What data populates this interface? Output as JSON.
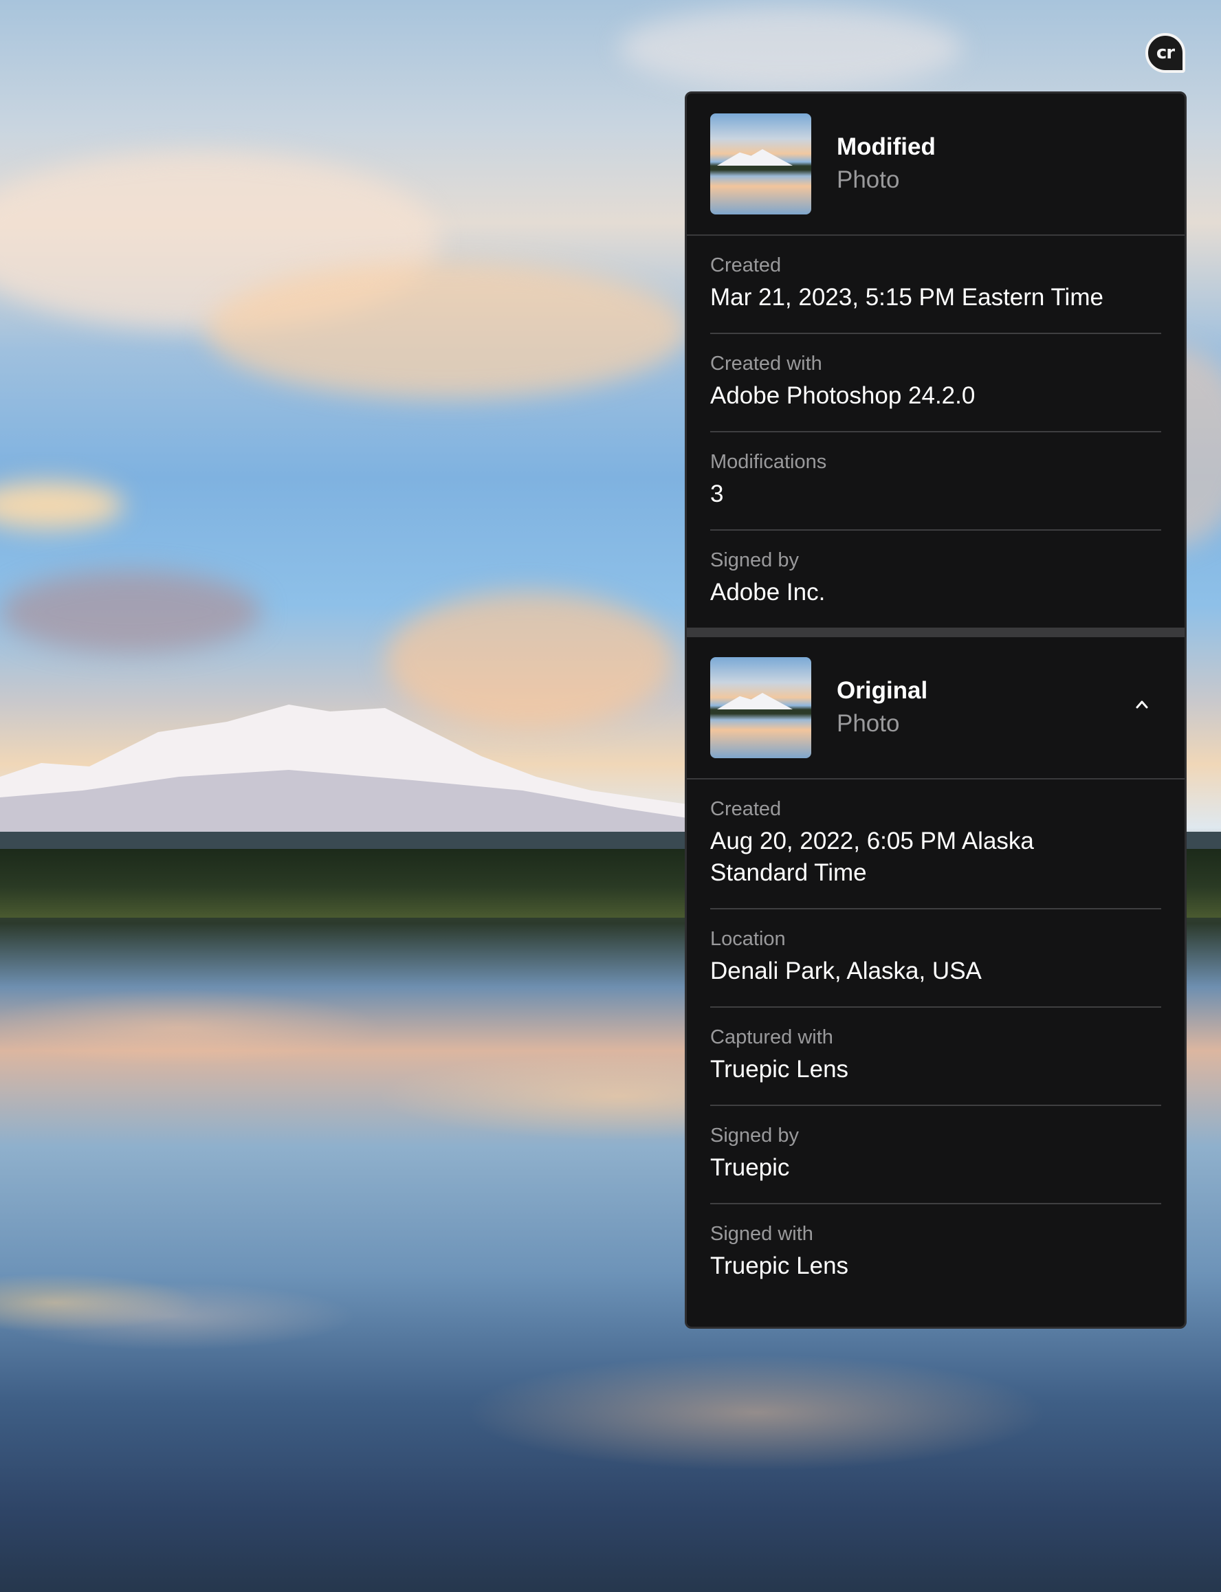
{
  "badge": {
    "label": "cr"
  },
  "modified": {
    "title": "Modified",
    "subtitle": "Photo",
    "rows": [
      {
        "label": "Created",
        "value": "Mar 21, 2023, 5:15 PM Eastern Time"
      },
      {
        "label": "Created with",
        "value": "Adobe Photoshop 24.2.0"
      },
      {
        "label": "Modifications",
        "value": "3"
      },
      {
        "label": "Signed by",
        "value": "Adobe Inc."
      }
    ]
  },
  "original": {
    "title": "Original",
    "subtitle": "Photo",
    "toggle_icon": "chevron-up-icon",
    "rows": [
      {
        "label": "Created",
        "value": "Aug 20, 2022, 6:05 PM Alaska Standard Time"
      },
      {
        "label": "Location",
        "value": "Denali Park, Alaska, USA"
      },
      {
        "label": "Captured with",
        "value": "Truepic Lens"
      },
      {
        "label": "Signed by",
        "value": "Truepic"
      },
      {
        "label": "Signed with",
        "value": "Truepic Lens"
      }
    ]
  },
  "colors": {
    "panel_bg": "#131314",
    "divider": "#3f3f41",
    "label_gray": "#9a9a9c",
    "text_white": "#ffffff"
  }
}
